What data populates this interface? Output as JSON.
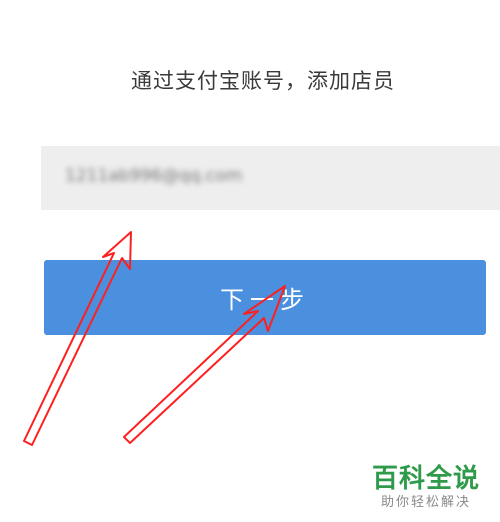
{
  "form": {
    "title": "通过支付宝账号，添加店员",
    "account_input": {
      "value": "1211ab996@qq.com",
      "blurred": true
    },
    "next_button_label": "下一步"
  },
  "annotation": {
    "arrow_color": "#ff1f1f",
    "arrow_count": 2
  },
  "watermark": {
    "main": "百科全说",
    "sub": "助你轻松解决",
    "color": "#2e9a4a"
  },
  "colors": {
    "button_blue": "#4a90df",
    "input_bg": "#eeeeee"
  }
}
